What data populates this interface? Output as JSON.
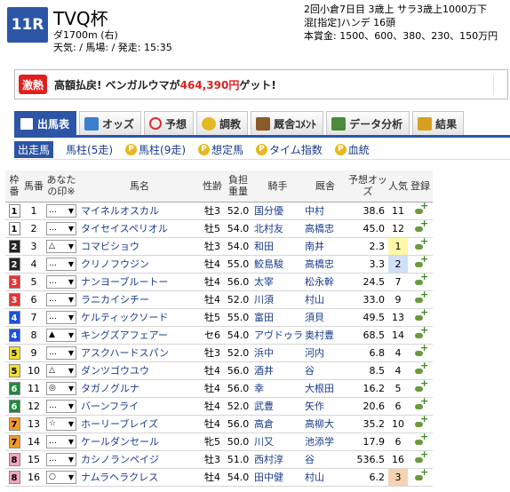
{
  "race": {
    "number": "11R",
    "name": "TVQ杯",
    "course": "ダ1700m (右)",
    "weather_line": "天気: / 馬場: / 発走: 15:35",
    "meta_line1": "2回小倉7日目 3歳上 サラ3歳上1000万下",
    "meta_line2": "混[指定]ハンデ 16頭",
    "meta_line3": "本賞金: 1500、600、380、230、150万円"
  },
  "banner": {
    "badge": "激熱",
    "text_before": "高額払戻! ベンガルウマが",
    "amount": "464,390円",
    "text_after": "ゲット!"
  },
  "tabs": [
    {
      "label": "出馬表",
      "icon": "table-icon"
    },
    {
      "label": "オッズ",
      "icon": "odds-icon"
    },
    {
      "label": "予想",
      "icon": "target-icon"
    },
    {
      "label": "調教",
      "icon": "stopwatch-icon"
    },
    {
      "label": "厩舎ｺﾒﾝﾄ",
      "icon": "stable-icon"
    },
    {
      "label": "データ分析",
      "icon": "chart-icon"
    },
    {
      "label": "結果",
      "icon": "coin-icon"
    }
  ],
  "subtabs": [
    {
      "label": "出走馬",
      "premium": false
    },
    {
      "label": "馬柱(5走)",
      "premium": false
    },
    {
      "label": "馬柱(9走)",
      "premium": true
    },
    {
      "label": "想定馬",
      "premium": true
    },
    {
      "label": "タイム指数",
      "premium": true
    },
    {
      "label": "血統",
      "premium": true
    }
  ],
  "premium_glyph": "P",
  "columns": {
    "waku": "枠番",
    "umaban": "馬番",
    "mark": "あなたの印※",
    "name": "馬名",
    "sexage": "性齢",
    "weight": "負担重量",
    "jockey": "騎手",
    "trainer": "厩舎",
    "odds": "予想オッズ",
    "pop": "人気",
    "reg": "登録"
  },
  "colors": {
    "accent": "#2d55a6",
    "waku": [
      "#ffffff",
      "#222222",
      "#e33535",
      "#1e50d8",
      "#f2e030",
      "#1f8a3c",
      "#f29b28",
      "#f3a6be"
    ]
  },
  "horses": [
    {
      "waku": "1",
      "num": "1",
      "mark": "…",
      "name": "マイネルオスカル",
      "sexage": "牡3",
      "weight": "52.0",
      "jockey": "国分優",
      "trainer": "中村",
      "odds": "38.6",
      "pop": "11"
    },
    {
      "waku": "1",
      "num": "2",
      "mark": "…",
      "name": "タイセイスペリオル",
      "sexage": "牡5",
      "weight": "54.0",
      "jockey": "北村友",
      "trainer": "高橋忠",
      "odds": "45.0",
      "pop": "12"
    },
    {
      "waku": "2",
      "num": "3",
      "mark": "△",
      "name": "コマビショウ",
      "sexage": "牡3",
      "weight": "54.0",
      "jockey": "和田",
      "trainer": "南井",
      "odds": "2.3",
      "pop": "1"
    },
    {
      "waku": "2",
      "num": "4",
      "mark": "…",
      "name": "クリノフウジン",
      "sexage": "牡4",
      "weight": "55.0",
      "jockey": "鮫島駿",
      "trainer": "高橋忠",
      "odds": "3.3",
      "pop": "2"
    },
    {
      "waku": "3",
      "num": "5",
      "mark": "…",
      "name": "ナンヨーブルートー",
      "sexage": "牡4",
      "weight": "56.0",
      "jockey": "太宰",
      "trainer": "松永幹",
      "odds": "24.5",
      "pop": "7"
    },
    {
      "waku": "3",
      "num": "6",
      "mark": "…",
      "name": "ラニカイシチー",
      "sexage": "牡4",
      "weight": "52.0",
      "jockey": "川須",
      "trainer": "村山",
      "odds": "33.0",
      "pop": "9"
    },
    {
      "waku": "4",
      "num": "7",
      "mark": "…",
      "name": "ケルティックソード",
      "sexage": "牡5",
      "weight": "55.0",
      "jockey": "富田",
      "trainer": "須貝",
      "odds": "49.5",
      "pop": "13"
    },
    {
      "waku": "4",
      "num": "8",
      "mark": "▲",
      "name": "キングズアフェアー",
      "sexage": "セ6",
      "weight": "54.0",
      "jockey": "アヴドゥラ",
      "trainer": "奥村豊",
      "odds": "68.5",
      "pop": "14"
    },
    {
      "waku": "5",
      "num": "9",
      "mark": "…",
      "name": "アスクハードスパン",
      "sexage": "牡3",
      "weight": "52.0",
      "jockey": "浜中",
      "trainer": "河内",
      "odds": "6.8",
      "pop": "4"
    },
    {
      "waku": "5",
      "num": "10",
      "mark": "△",
      "name": "ダンツゴウユウ",
      "sexage": "牡4",
      "weight": "56.0",
      "jockey": "酒井",
      "trainer": "谷",
      "odds": "8.5",
      "pop": "4"
    },
    {
      "waku": "6",
      "num": "11",
      "mark": "◎",
      "name": "タガノグルナ",
      "sexage": "牡4",
      "weight": "56.0",
      "jockey": "幸",
      "trainer": "大根田",
      "odds": "16.2",
      "pop": "5"
    },
    {
      "waku": "6",
      "num": "12",
      "mark": "…",
      "name": "バーンフライ",
      "sexage": "牡4",
      "weight": "52.0",
      "jockey": "武豊",
      "trainer": "矢作",
      "odds": "20.6",
      "pop": "6"
    },
    {
      "waku": "7",
      "num": "13",
      "mark": "☆",
      "name": "ホーリーブレイズ",
      "sexage": "牡4",
      "weight": "56.0",
      "jockey": "高倉",
      "trainer": "高柳大",
      "odds": "35.2",
      "pop": "10"
    },
    {
      "waku": "7",
      "num": "14",
      "mark": "…",
      "name": "ケールダンセール",
      "sexage": "牝5",
      "weight": "50.0",
      "jockey": "川又",
      "trainer": "池添学",
      "odds": "17.9",
      "pop": "6"
    },
    {
      "waku": "8",
      "num": "15",
      "mark": "…",
      "name": "カシノランペイジ",
      "sexage": "牡3",
      "weight": "51.0",
      "jockey": "西村淳",
      "trainer": "谷",
      "odds": "536.5",
      "pop": "16"
    },
    {
      "waku": "8",
      "num": "16",
      "mark": "○",
      "name": "ナムラヘラクレス",
      "sexage": "牡4",
      "weight": "54.0",
      "jockey": "田中健",
      "trainer": "村山",
      "odds": "6.2",
      "pop": "3"
    }
  ]
}
